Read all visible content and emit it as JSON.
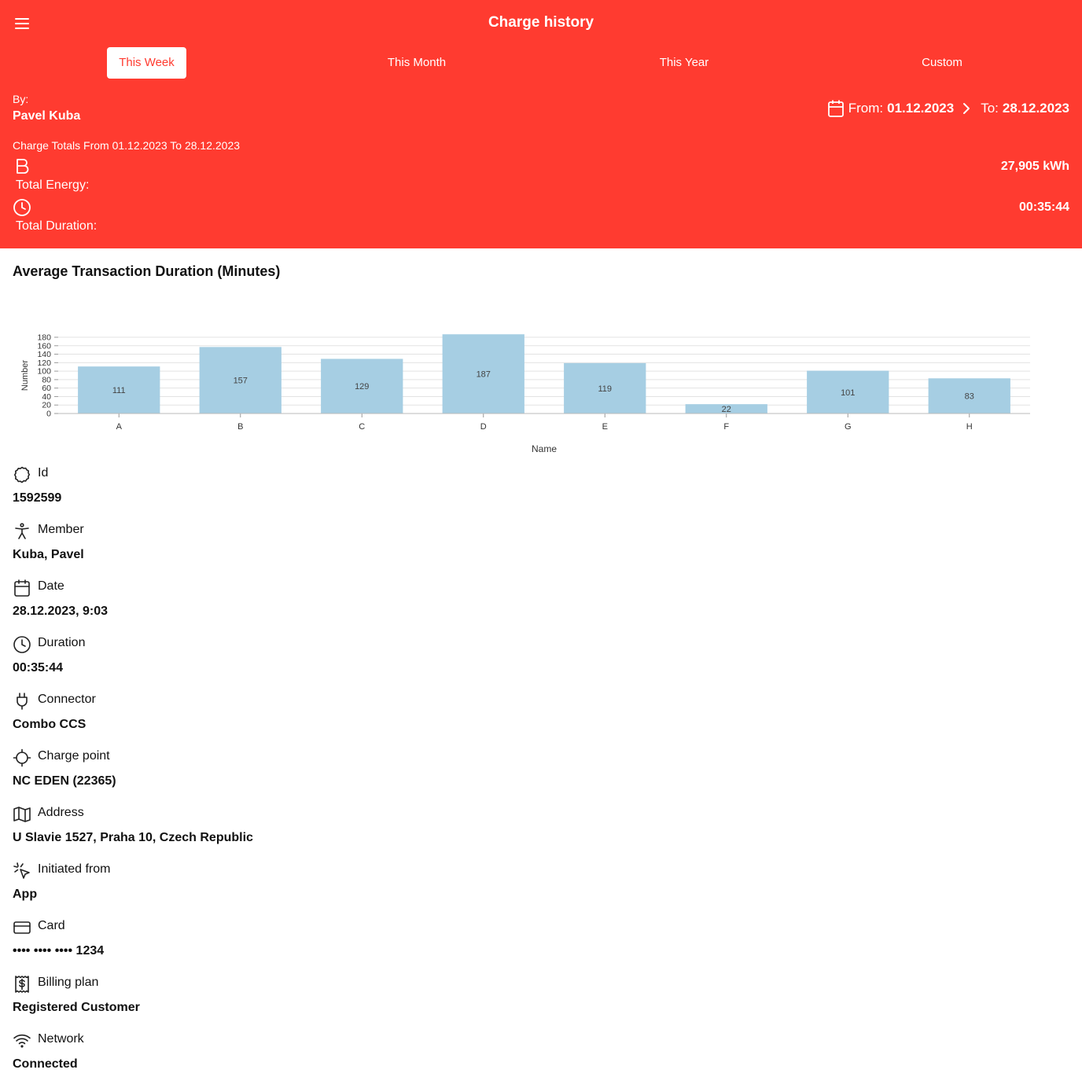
{
  "header": {
    "title": "Charge history",
    "tabs": [
      {
        "label": "This Week",
        "active": true
      },
      {
        "label": "This Month",
        "active": false
      },
      {
        "label": "This Year",
        "active": false
      },
      {
        "label": "Custom",
        "active": false
      }
    ],
    "by_label": "By:",
    "by_name": "Pavel Kuba",
    "range": {
      "from_label": "From:",
      "from_value": "01.12.2023",
      "to_label": "To:",
      "to_value": "28.12.2023"
    },
    "totals_label": "Charge Totals From 01.12.2023 To 28.12.2023",
    "total_energy": {
      "label": "Total Energy:",
      "value": "27,905 kWh",
      "icon": "bolt-icon"
    },
    "total_duration": {
      "label": "Total Duration:",
      "value": "00:35:44",
      "icon": "clock-icon"
    },
    "accent_color": "#ff3b30"
  },
  "chart": {
    "heading": "Average Transaction Duration (Minutes)"
  },
  "chart_data": {
    "type": "bar",
    "categories": [
      "A",
      "B",
      "C",
      "D",
      "E",
      "F",
      "G",
      "H"
    ],
    "values": [
      111,
      157,
      129,
      187,
      119,
      22,
      101,
      83
    ],
    "xlabel": "Name",
    "ylabel": "Number",
    "ylim": [
      0,
      180
    ],
    "yticks": [
      0,
      20,
      40,
      60,
      80,
      100,
      120,
      140,
      160,
      180
    ],
    "grid": true,
    "bar_color": "#a6cee3"
  },
  "details": [
    {
      "icon": "badge-icon",
      "label": "Id",
      "value": "1592599"
    },
    {
      "icon": "person-icon",
      "label": "Member",
      "value": "Kuba, Pavel"
    },
    {
      "icon": "calendar-icon",
      "label": "Date",
      "value": "28.12.2023, 9:03"
    },
    {
      "icon": "clock-icon",
      "label": "Duration",
      "value": "00:35:44"
    },
    {
      "icon": "plug-icon",
      "label": "Connector",
      "value": "Combo CCS"
    },
    {
      "icon": "crosshair-icon",
      "label": "Charge point",
      "value": "NC EDEN (22365)"
    },
    {
      "icon": "map-icon",
      "label": "Address",
      "value": "U Slavie 1527, Praha 10, Czech Republic"
    },
    {
      "icon": "pointer-click-icon",
      "label": "Initiated from",
      "value": "App"
    },
    {
      "icon": "credit-card-icon",
      "label": "Card",
      "value": "•••• •••• •••• 1234"
    },
    {
      "icon": "receipt-dollar-icon",
      "label": "Billing plan",
      "value": "Registered Customer"
    },
    {
      "icon": "wifi-icon",
      "label": "Network",
      "value": "Connected"
    }
  ]
}
